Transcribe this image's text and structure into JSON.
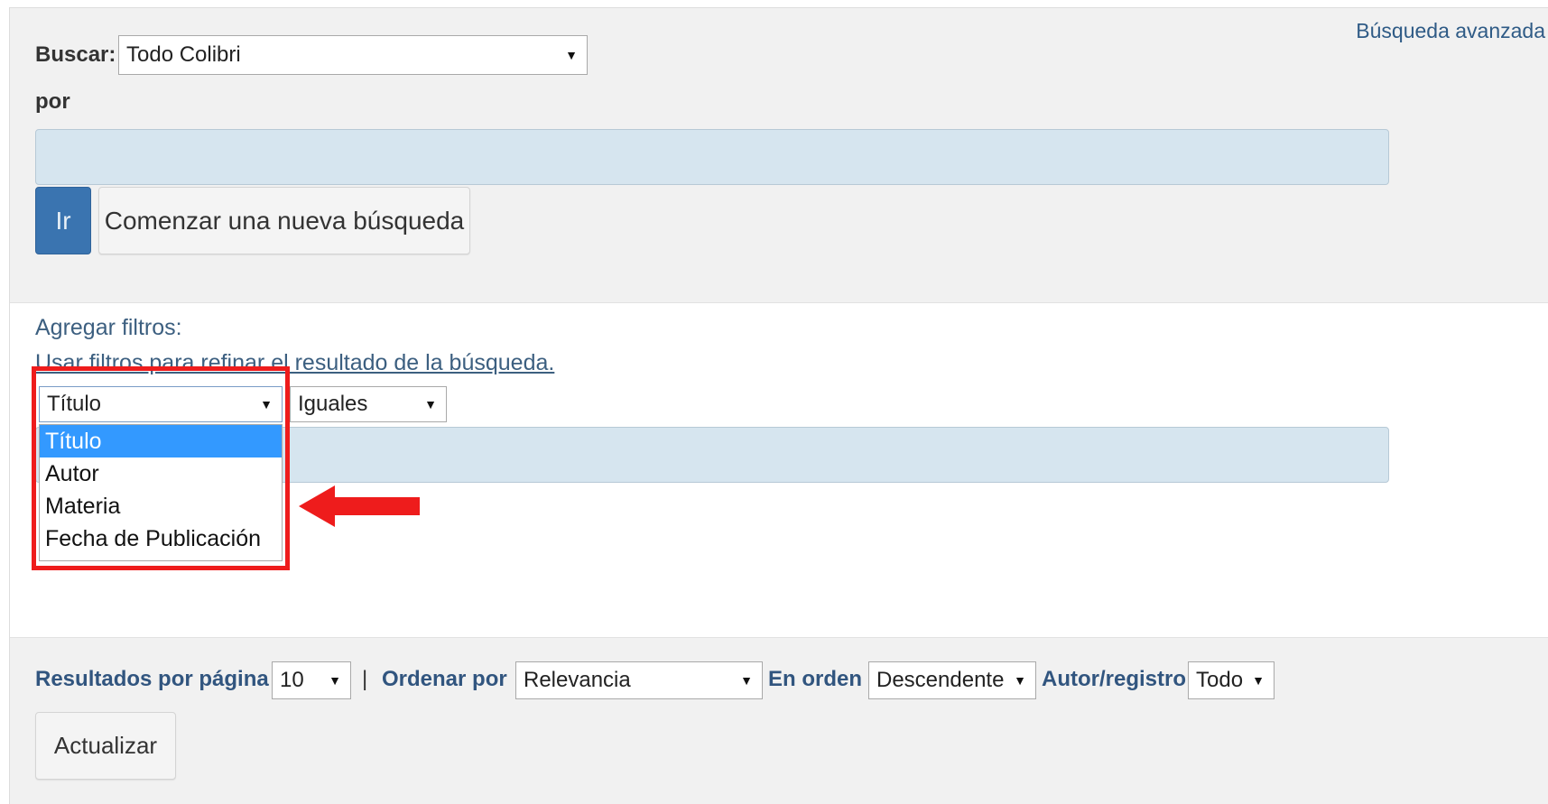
{
  "search": {
    "advanced_link": "Búsqueda avanzada",
    "buscar_label": "Buscar:",
    "scope_selected": "Todo Colibri",
    "por_label": "por",
    "query_value": "",
    "go_button": "Ir",
    "new_search_button": "Comenzar una nueva búsqueda"
  },
  "filters": {
    "heading": "Agregar filtros:",
    "help_text": "Usar filtros para refinar el resultado de la búsqueda.",
    "field_selected": "Título",
    "operator_selected": "Iguales",
    "value": "",
    "field_options": [
      "Título",
      "Autor",
      "Materia",
      "Fecha de Publicación"
    ],
    "highlight_color": "#ee1c1c"
  },
  "options": {
    "per_page_label": "Resultados por página",
    "per_page_value": "10",
    "separator": "|",
    "sort_label": "Ordenar por",
    "sort_value": "Relevancia",
    "order_label": "En orden",
    "order_value": "Descendente",
    "author_label": "Autor/registro",
    "author_value": "Todo",
    "update_button": "Actualizar"
  },
  "icons": {
    "dropdown_arrow": "▼"
  },
  "colors": {
    "primary_button": "#3a74b0",
    "label_blue": "#31557f",
    "input_bg": "#d6e5ef",
    "selected_option": "#3399ff"
  }
}
